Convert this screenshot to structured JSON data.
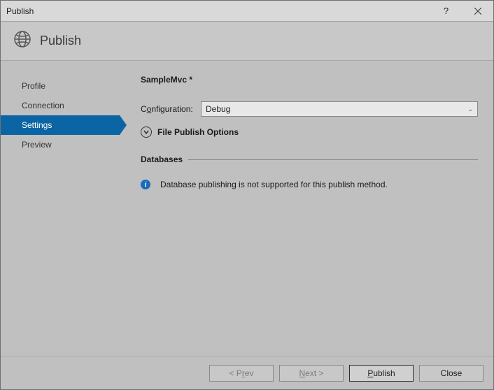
{
  "window": {
    "title": "Publish"
  },
  "header": {
    "title": "Publish"
  },
  "sidebar": {
    "items": [
      {
        "label": "Profile"
      },
      {
        "label": "Connection"
      },
      {
        "label": "Settings"
      },
      {
        "label": "Preview"
      }
    ]
  },
  "content": {
    "profile_name": "SampleMvc *",
    "config_label_pre": "C",
    "config_label_ul": "o",
    "config_label_post": "nfiguration:",
    "config_value": "Debug",
    "file_publish_label": "File Publish Options",
    "databases_heading": "Databases",
    "db_message": "Database publishing is not supported for this publish method."
  },
  "footer": {
    "prev_pre": "< P",
    "prev_ul": "r",
    "prev_post": "ev",
    "next_ul": "N",
    "next_post": "ext >",
    "publish_ul": "P",
    "publish_post": "ublish",
    "close": "Close"
  }
}
